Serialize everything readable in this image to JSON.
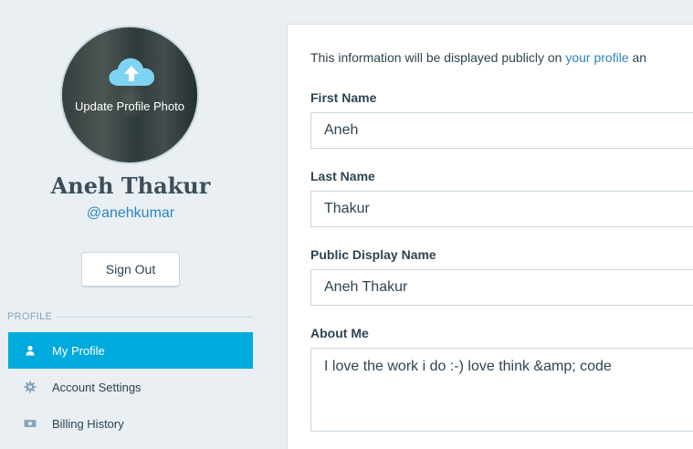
{
  "profile": {
    "photo_button_label": "Update Profile Photo",
    "name": "Aneh Thakur",
    "handle": "@anehkumar",
    "sign_out_label": "Sign Out"
  },
  "sidebar": {
    "section_title": "PROFILE",
    "items": [
      {
        "label": "My Profile",
        "icon": "person-icon",
        "active": true
      },
      {
        "label": "Account Settings",
        "icon": "gear-icon",
        "active": false
      },
      {
        "label": "Billing History",
        "icon": "credit-card-icon",
        "active": false
      }
    ]
  },
  "form": {
    "intro_text": "This information will be displayed publicly on ",
    "intro_link": "your profile",
    "intro_tail": " an",
    "fields": [
      {
        "label": "First Name",
        "value": "Aneh"
      },
      {
        "label": "Last Name",
        "value": "Thakur"
      },
      {
        "label": "Public Display Name",
        "value": "Aneh Thakur"
      },
      {
        "label": "About Me",
        "value": "I love the work i do :-) love think &amp; code"
      }
    ]
  },
  "colors": {
    "accent": "#00aadc",
    "link": "#2e86c1",
    "background": "#e9eff3",
    "text": "#2e4453",
    "border": "#c8d7e1"
  }
}
